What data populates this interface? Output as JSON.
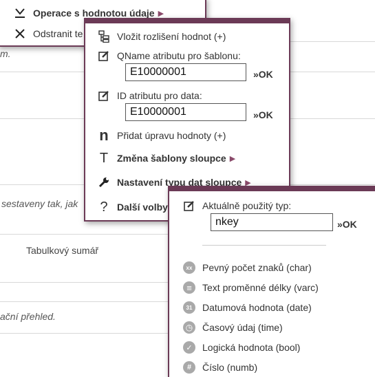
{
  "top_menu": {
    "items": [
      {
        "label": "Operace s hodnotou údaje",
        "icon": "check-down-icon",
        "has_submenu": true
      },
      {
        "label": "Odstranit te",
        "icon": "close-icon",
        "has_submenu": false
      }
    ]
  },
  "background": {
    "text_m": "m.",
    "text_sestaveny": "sestaveny tak, jak",
    "text_sumar": "Tabulkový sumář",
    "text_prehled": "ační přehled."
  },
  "menu2": {
    "items": {
      "vlozit": "Vložit rozlišení hodnot (+)",
      "qname_label": "QName atributu pro šablonu:",
      "qname_value": "E10000001",
      "id_label": "ID atributu pro data:",
      "id_value": "E10000001",
      "pridat": "Přidat úpravu hodnoty (+)",
      "zmena": "Změna šablony sloupce",
      "nastaveni": "Nastavení typu dat sloupce",
      "dalsi": "Další volby"
    },
    "ok_label": "»OK"
  },
  "menu3": {
    "type_label": "Aktuálně použitý typ:",
    "type_value": "nkey",
    "ok_label": "»OK",
    "types": [
      {
        "label": "Pevný počet znaků (char)",
        "icon_text": "xx"
      },
      {
        "label": "Text proměnné délky (varc)",
        "icon_text": "≡"
      },
      {
        "label": "Datumová hodnota (date)",
        "icon_text": "31"
      },
      {
        "label": "Časový údaj (time)",
        "icon_text": "◷"
      },
      {
        "label": "Logická hodnota (bool)",
        "icon_text": "✓"
      },
      {
        "label": "Číslo (numb)",
        "icon_text": "#"
      }
    ]
  },
  "colors": {
    "accent": "#6b3a56",
    "arrow": "#8a4a6a",
    "icon_gray": "#a9a9a9"
  }
}
